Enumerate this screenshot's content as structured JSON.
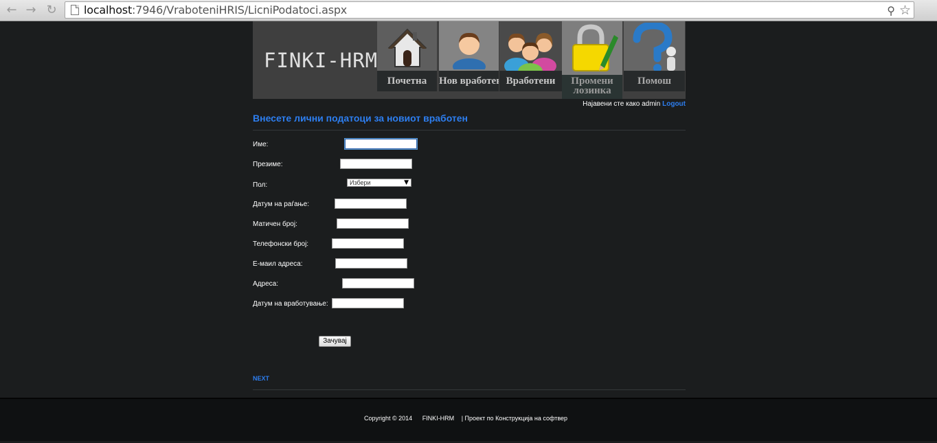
{
  "browser": {
    "url_host": "localhost",
    "url_rest": ":7946/VraboteniHRIS/LicniPodatoci.aspx"
  },
  "header": {
    "logo": "FINKI-HRM",
    "menu": [
      {
        "label": "Почетна",
        "icon": "house-icon"
      },
      {
        "label": "Нов вработен",
        "icon": "person-icon"
      },
      {
        "label": "Вработени",
        "icon": "people-icon"
      },
      {
        "label": "Промени лозинка",
        "icon": "lock-pencil-icon"
      },
      {
        "label": "Помош",
        "icon": "question-icon"
      }
    ]
  },
  "login": {
    "text": "Најавени сте како admin",
    "logout": "Logout"
  },
  "page_title": "Внесете лични податоци за новиот вработен",
  "form": {
    "first_name_label": "Име:",
    "last_name_label": "Презиме:",
    "gender_label": "Пол:",
    "gender_selected": "Избери",
    "birth_date_label": "Датум на раѓање:",
    "id_number_label": "Матичен број:",
    "phone_label": "Телефонски број:",
    "email_label": "Е-маил адреса:",
    "address_label": "Адреса:",
    "hire_date_label": "Датум на вработување:",
    "save_label": "Зачувај"
  },
  "next_label": "NEXT",
  "footer": {
    "copyright": "Copyright © 2014",
    "brand": "FINKI-HRM",
    "project": "| Проект по Конструкција на софтвер"
  },
  "colors": {
    "accent": "#2d7ef0",
    "background": "#1b1d1e"
  }
}
